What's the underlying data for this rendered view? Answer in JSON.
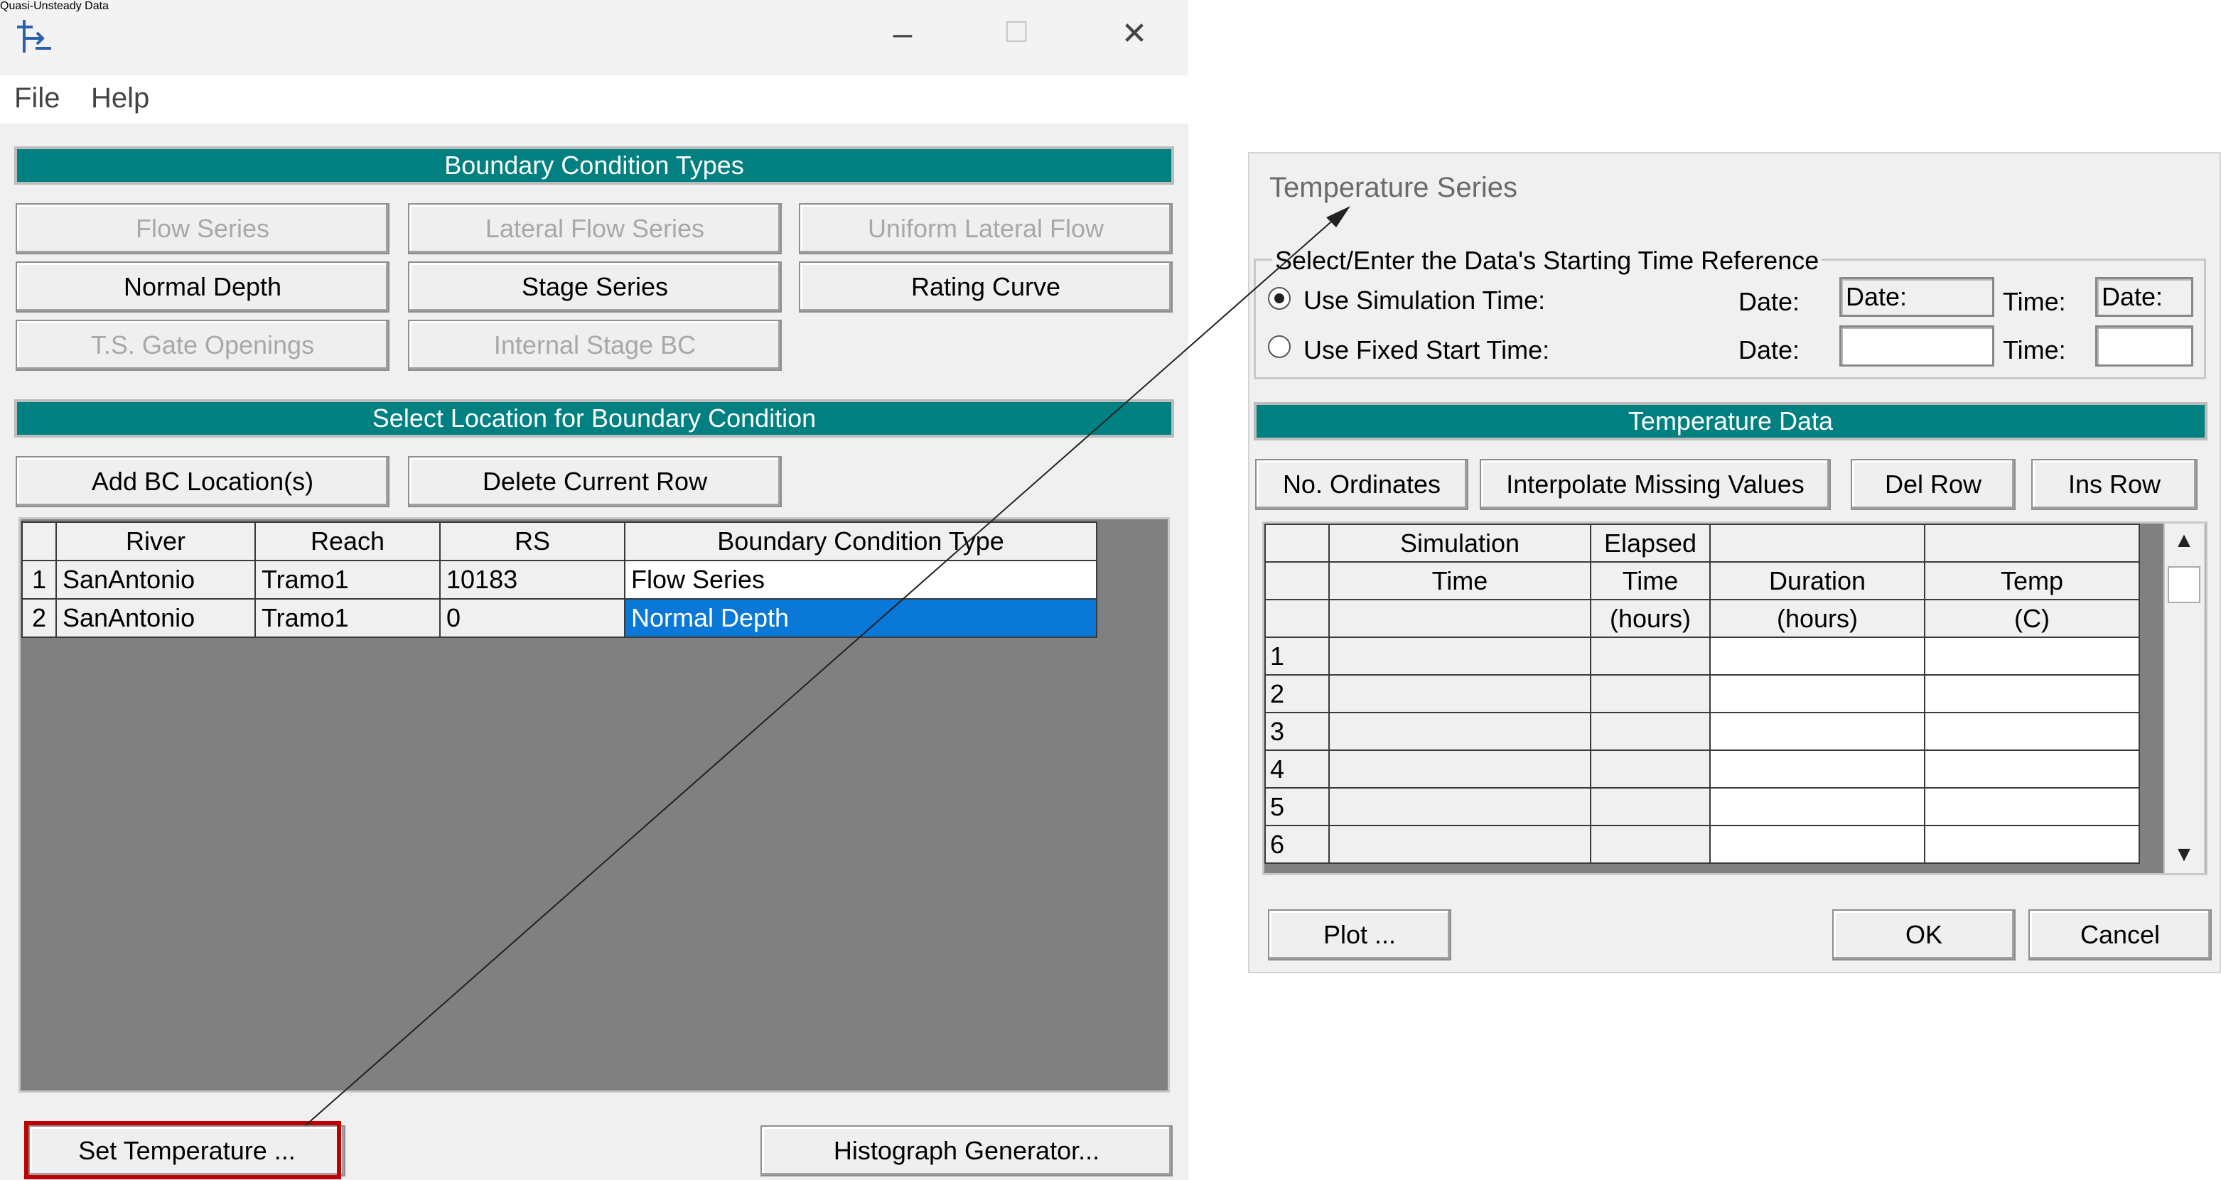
{
  "window_main": {
    "title": "Quasi-Unsteady Data",
    "controls": {
      "minimize": "–",
      "maximize": "☐",
      "close": "✕"
    },
    "menu": [
      "File",
      "Help"
    ],
    "bc_types_header": "Boundary Condition Types",
    "bc_buttons": [
      {
        "label": "Flow Series",
        "enabled": false
      },
      {
        "label": "Lateral Flow Series",
        "enabled": false
      },
      {
        "label": "Uniform Lateral Flow",
        "enabled": false
      },
      {
        "label": "Normal Depth",
        "enabled": true
      },
      {
        "label": "Stage Series",
        "enabled": true
      },
      {
        "label": "Rating Curve",
        "enabled": true
      },
      {
        "label": "T.S. Gate Openings",
        "enabled": false
      },
      {
        "label": "Internal Stage BC",
        "enabled": false
      }
    ],
    "location_header": "Select Location for Boundary Condition",
    "add_bc_label": "Add BC Location(s)",
    "delete_row_label": "Delete Current Row",
    "table": {
      "columns": [
        "River",
        "Reach",
        "RS",
        "Boundary Condition Type"
      ],
      "rows": [
        {
          "n": "1",
          "river": "SanAntonio",
          "reach": "Tramo1",
          "rs": "10183",
          "bc": "Flow Series"
        },
        {
          "n": "2",
          "river": "SanAntonio",
          "reach": "Tramo1",
          "rs": "0",
          "bc": "Normal Depth"
        }
      ]
    },
    "set_temperature_label": "Set Temperature ...",
    "histograph_label": "Histograph Generator..."
  },
  "window_temp": {
    "title": "Temperature Series",
    "group_label": "Select/Enter the Data's Starting Time Reference",
    "use_sim_time": "Use Simulation Time:",
    "use_fixed_time": "Use Fixed Start Time:",
    "date_label": "Date:",
    "time_label": "Time:",
    "sim_date_value": "Date:",
    "sim_time_value": "Date:",
    "fixed_date_value": "",
    "fixed_time_value": "",
    "selected_radio": "simulation",
    "data_header": "Temperature Data",
    "buttons": {
      "ordinates": "No. Ordinates",
      "interpolate": "Interpolate Missing Values",
      "del_row": "Del Row",
      "ins_row": "Ins Row",
      "plot": "Plot ...",
      "ok": "OK",
      "cancel": "Cancel"
    },
    "columns": {
      "sim_1": "Simulation",
      "sim_2": "Time",
      "elapsed_1": "Elapsed",
      "elapsed_2": "Time",
      "elapsed_3": "(hours)",
      "duration_2": "Duration",
      "duration_3": "(hours)",
      "temp_2": "Temp",
      "temp_3": "(C)"
    },
    "row_numbers": [
      "1",
      "2",
      "3",
      "4",
      "5",
      "6"
    ],
    "scroll_up": "▲",
    "scroll_down": "▼"
  }
}
